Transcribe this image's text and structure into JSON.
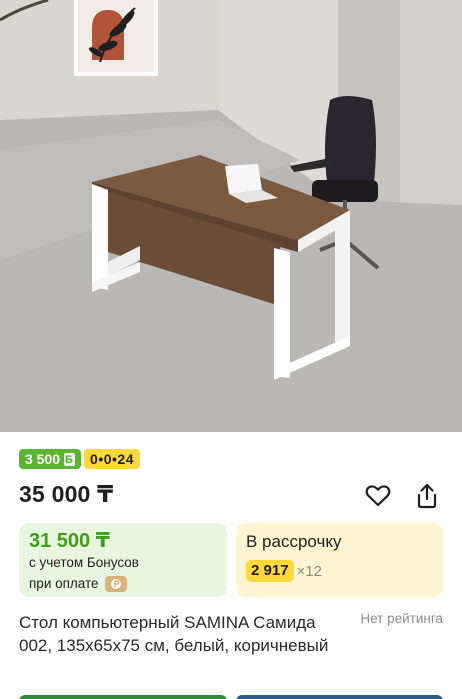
{
  "photo": {
    "alt_icon": "product-photo"
  },
  "badges": {
    "bonus": "3 500",
    "installment": "0•0•24"
  },
  "price": "35 000 ₸",
  "bonus_card": {
    "price": "31 500 ₸",
    "line1": "с учетом Бонусов",
    "line2": "при оплате"
  },
  "installment_card": {
    "title": "В рассрочку",
    "amount": "2 917",
    "multiplier": "×12"
  },
  "product": {
    "title": "Стол компьютерный SAMINA Самида 002, 135х65х75 см, белый, коричневый",
    "rating": "Нет рейтинга"
  },
  "colors": {
    "bonus_green": "#5cb531",
    "installment_yellow": "#ffd83b"
  },
  "icons": {
    "favorite": "heart-icon",
    "share": "share-icon",
    "payment": "payment-icon"
  }
}
